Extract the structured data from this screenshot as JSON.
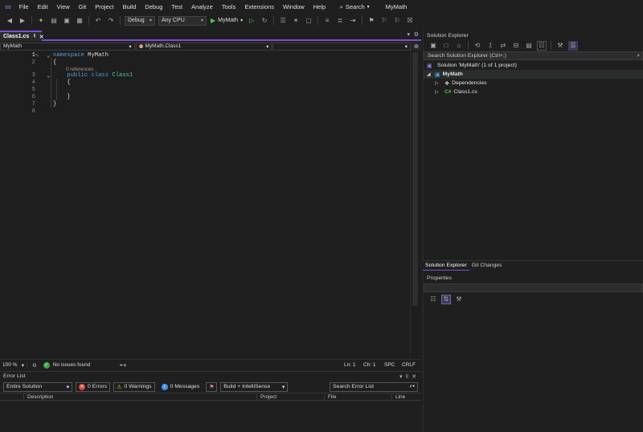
{
  "menubar": {
    "items": [
      "File",
      "Edit",
      "View",
      "Git",
      "Project",
      "Build",
      "Debug",
      "Test",
      "Analyze",
      "Tools",
      "Extensions",
      "Window",
      "Help"
    ],
    "search_label": "Search",
    "app_name": "MyMath"
  },
  "toolbar": {
    "config": "Debug",
    "platform": "Any CPU",
    "run_target": "MyMath"
  },
  "document_tab": {
    "title": "Class1.cs"
  },
  "navbar": {
    "project": "MyMath",
    "type": "MyMath.Class1",
    "member": ""
  },
  "editor": {
    "line_numbers": [
      "1",
      "2",
      "3",
      "4",
      "5",
      "6",
      "7",
      "8"
    ],
    "codelens": "0 references",
    "lines": [
      {
        "kw": "namespace",
        "rest": " MyMath"
      },
      {
        "text": "{"
      },
      {
        "kw1": "public",
        "kw2": "class",
        "type": "Class1"
      },
      {
        "text": "    {"
      },
      {
        "text": ""
      },
      {
        "text": "    }"
      },
      {
        "text": "}"
      },
      {
        "text": ""
      }
    ]
  },
  "editor_status": {
    "zoom": "100 %",
    "issues": "No issues found",
    "ln": "Ln: 1",
    "ch": "Ch: 1",
    "spc": "SPC",
    "crlf": "CRLF"
  },
  "error_list": {
    "title": "Error List",
    "scope": "Entire Solution",
    "errors": "0 Errors",
    "warnings": "0 Warnings",
    "messages": "0 Messages",
    "build_filter": "Build + IntelliSense",
    "search_placeholder": "Search Error List",
    "columns": [
      "Description",
      "Project",
      "File",
      "Line"
    ]
  },
  "solution_explorer": {
    "title": "Solution Explorer",
    "search_placeholder": "Search Solution Explorer (Ctrl+;)",
    "solution": "Solution 'MyMath' (1 of 1 project)",
    "project": "MyMath",
    "items": [
      "Dependencies",
      "Class1.cs"
    ]
  },
  "side_tabs": [
    "Solution Explorer",
    "Git Changes"
  ],
  "properties": {
    "title": "Properties"
  },
  "colors": {
    "accent": "#7a4fd6",
    "keyword": "#569cd6",
    "type": "#4ec9b0",
    "background": "#1f1f1f"
  }
}
